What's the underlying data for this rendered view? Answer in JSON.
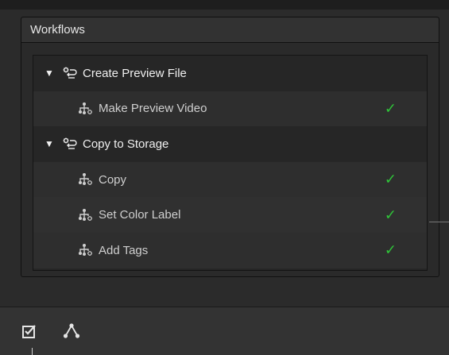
{
  "panel": {
    "title": "Workflows"
  },
  "workflows": [
    {
      "name": "Create Preview File",
      "icon": "workflow-gear-icon",
      "expanded": true,
      "steps": [
        {
          "name": "Make Preview Video",
          "icon": "node-graph-gear-icon",
          "status": "done"
        }
      ]
    },
    {
      "name": "Copy to Storage",
      "icon": "workflow-gear-icon",
      "expanded": true,
      "steps": [
        {
          "name": "Copy",
          "icon": "node-graph-gear-icon",
          "status": "done"
        },
        {
          "name": "Set Color Label",
          "icon": "node-graph-gear-icon",
          "status": "done"
        },
        {
          "name": "Add Tags",
          "icon": "node-graph-gear-icon",
          "status": "done"
        }
      ]
    }
  ],
  "toolbar": {
    "buttons": [
      {
        "icon": "checkbox-icon"
      },
      {
        "icon": "node-graph-icon"
      }
    ]
  },
  "colors": {
    "check": "#2fc439",
    "background": "#2b2b2b",
    "panel_header": "#323232"
  }
}
